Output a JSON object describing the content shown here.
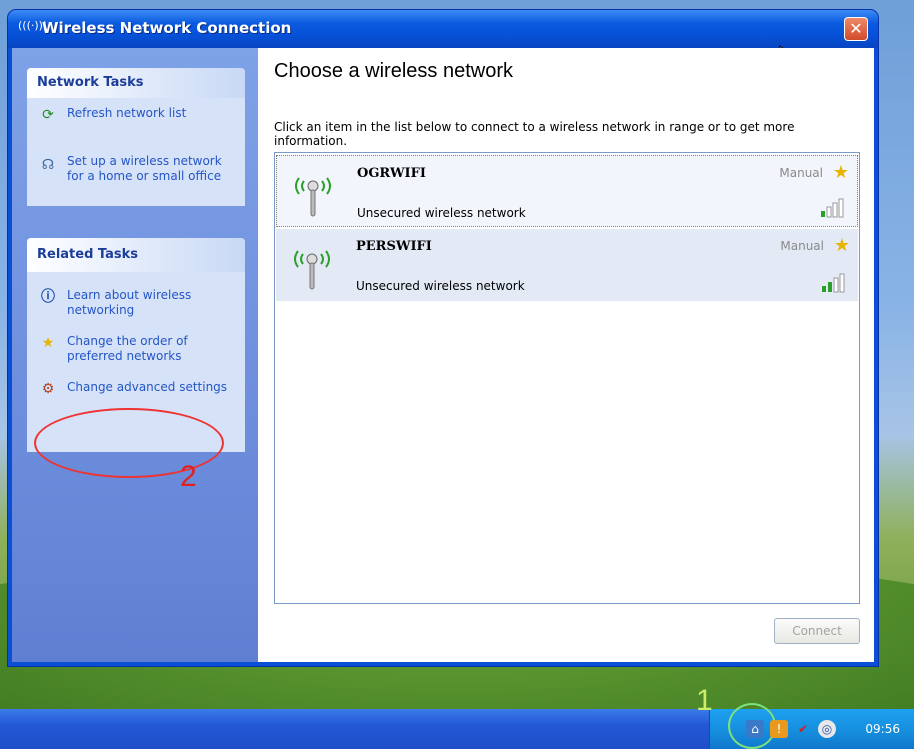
{
  "window": {
    "title": "Wireless Network Connection"
  },
  "sidebar": {
    "network_tasks": {
      "heading": "Network Tasks",
      "items": [
        {
          "label": "Refresh network list",
          "icon": "refresh-icon"
        },
        {
          "label": "Set up a wireless network for a home or small office",
          "icon": "setup-wizard-icon"
        }
      ]
    },
    "related_tasks": {
      "heading": "Related Tasks",
      "items": [
        {
          "label": "Learn about wireless networking",
          "icon": "info-icon"
        },
        {
          "label": "Change the order of preferred networks",
          "icon": "star-icon"
        },
        {
          "label": "Change advanced settings",
          "icon": "settings-icon"
        }
      ]
    }
  },
  "main": {
    "title": "Choose a wireless network",
    "description": "Click an item in the list below to connect to a wireless network in range or to get more information.",
    "networks": [
      {
        "name": "OGRWIFI",
        "status": "Unsecured wireless network",
        "type": "Manual"
      },
      {
        "name": "PERSWIFI",
        "status": "Unsecured wireless network",
        "type": "Manual"
      }
    ],
    "connect_label": "Connect"
  },
  "annotations": {
    "step1": "1",
    "step2": "2"
  },
  "taskbar": {
    "clock": "09:56"
  },
  "colors": {
    "title_blue": "#0a5ae0",
    "annotation_red": "#e33",
    "tray_highlight": "#7de07d"
  }
}
